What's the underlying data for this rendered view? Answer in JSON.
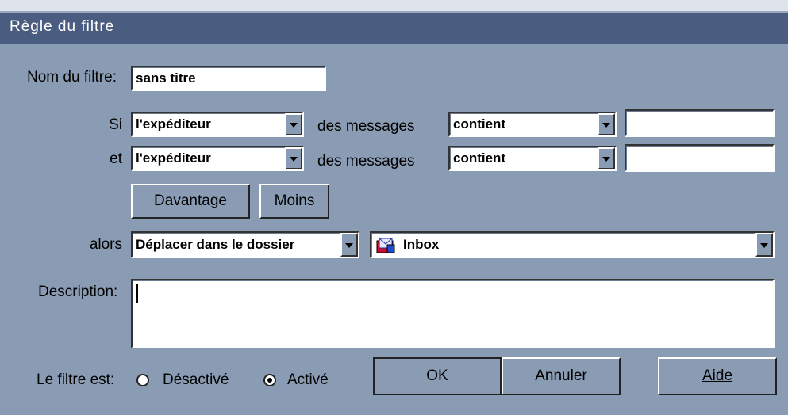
{
  "window": {
    "title": "Règle du filtre"
  },
  "form": {
    "name_label": "Nom du filtre:",
    "name_value": "sans titre",
    "if_label": "Si",
    "and_label": "et",
    "then_label": "alors",
    "messages_text": "des messages",
    "rules": [
      {
        "field": "l'expéditeur",
        "operator": "contient",
        "value": ""
      },
      {
        "field": "l'expéditeur",
        "operator": "contient",
        "value": ""
      }
    ],
    "more_button": "Davantage",
    "less_button": "Moins",
    "action": "Déplacer dans le dossier",
    "folder": "Inbox",
    "description_label": "Description:",
    "description_value": "",
    "status_label": "Le filtre est:",
    "disabled_option": "Désactivé",
    "enabled_option": "Activé",
    "status_selected": "Activé"
  },
  "buttons": {
    "ok": "OK",
    "cancel": "Annuler",
    "help": "Aide"
  },
  "colors": {
    "background": "#8a9cb4",
    "titlebar": "#4a5d80"
  }
}
